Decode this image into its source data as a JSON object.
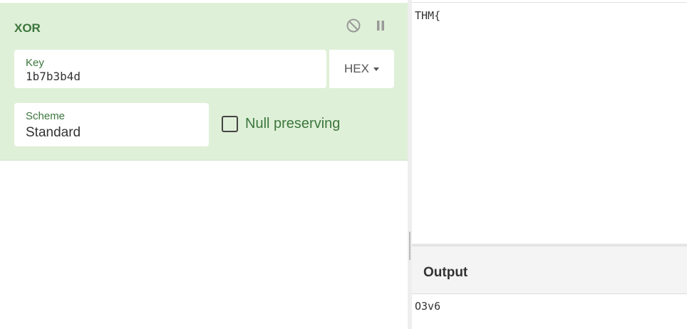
{
  "colors": {
    "operation_bg": "#dff0d8",
    "label_green": "#3c763d",
    "icon_gray": "#9a9a9a"
  },
  "recipe": {
    "operation": {
      "title": "XOR",
      "disable_icon": "disable-icon",
      "pause_icon": "pause-icon",
      "key": {
        "label": "Key",
        "value": "1b7b3b4d",
        "format": "HEX",
        "format_icon": "caret-down-icon"
      },
      "scheme": {
        "label": "Scheme",
        "value": "Standard"
      },
      "null_preserving": {
        "label": "Null preserving",
        "checked": false
      }
    }
  },
  "input": {
    "text": "THM{"
  },
  "output": {
    "title": "Output",
    "text": "O3v6"
  }
}
